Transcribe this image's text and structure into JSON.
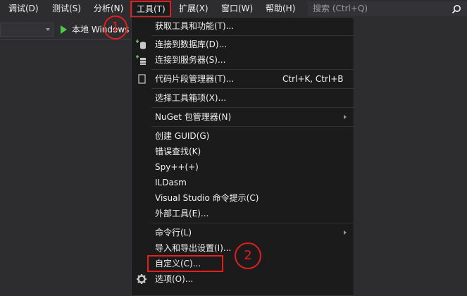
{
  "menubar": {
    "items": [
      {
        "label": "调试(D)"
      },
      {
        "label": "测试(S)"
      },
      {
        "label": "分析(N)"
      },
      {
        "label": "工具(T)"
      },
      {
        "label": "扩展(X)"
      },
      {
        "label": "窗口(W)"
      },
      {
        "label": "帮助(H)"
      }
    ],
    "search_placeholder": "搜索 (Ctrl+Q)"
  },
  "toolbar": {
    "run_label": "本地 Windows"
  },
  "annotations": {
    "step1": "1",
    "step2": "2",
    "color": "#e41e1e"
  },
  "tools_menu": {
    "items": [
      {
        "label": "获取工具和功能(T)..."
      },
      {
        "label": "连接到数据库(D)...",
        "icon": "database-connect-icon"
      },
      {
        "label": "连接到服务器(S)...",
        "icon": "server-connect-icon"
      },
      {
        "label": "代码片段管理器(T)...",
        "shortcut": "Ctrl+K, Ctrl+B",
        "icon": "snippet-icon"
      },
      {
        "label": "选择工具箱项(X)..."
      },
      {
        "label": "NuGet 包管理器(N)",
        "submenu": true
      },
      {
        "label": "创建 GUID(G)"
      },
      {
        "label": "错误查找(K)"
      },
      {
        "label": "Spy++(+)"
      },
      {
        "label": "ILDasm"
      },
      {
        "label": "Visual Studio 命令提示(C)"
      },
      {
        "label": "外部工具(E)..."
      },
      {
        "label": "命令行(L)",
        "submenu": true
      },
      {
        "label": "导入和导出设置(I)..."
      },
      {
        "label": "自定义(C)..."
      },
      {
        "label": "选项(O)...",
        "icon": "gear-icon"
      }
    ]
  }
}
